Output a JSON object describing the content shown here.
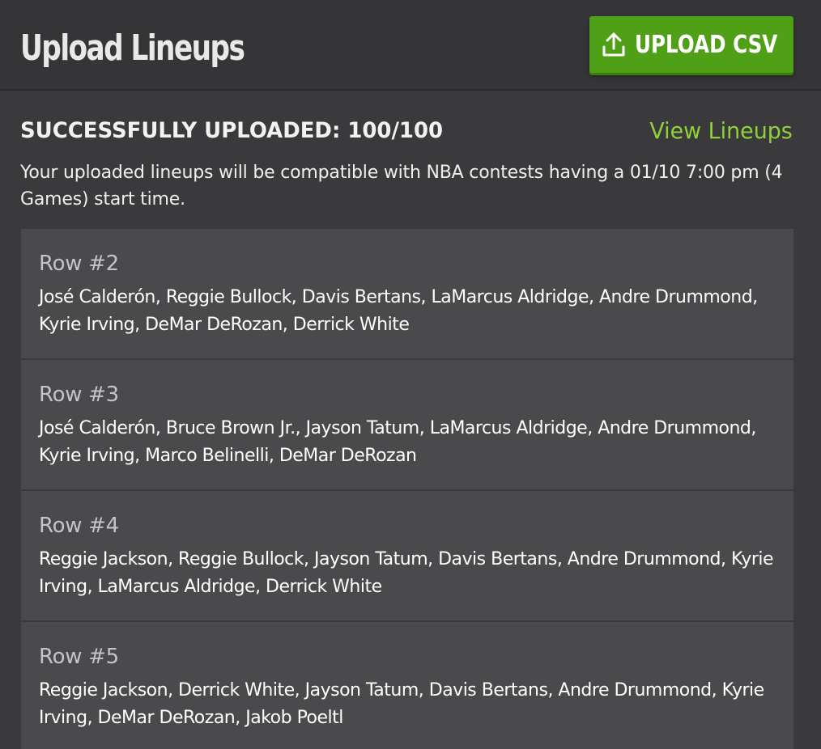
{
  "header": {
    "title": "Upload Lineups",
    "upload_button_label": "UPLOAD CSV",
    "upload_icon": "upload-icon"
  },
  "status": {
    "heading": "SUCCESSFULLY UPLOADED: 100/100",
    "view_link": "View Lineups",
    "description": "Your uploaded lineups will be compatible with NBA contests having a 01/10 7:00 pm (4 Games) start time."
  },
  "rows": [
    {
      "title": "Row #2",
      "players": "José Calderón, Reggie Bullock, Davis Bertans, LaMarcus Aldridge, Andre Drummond, Kyrie Irving, DeMar DeRozan, Derrick White"
    },
    {
      "title": "Row #3",
      "players": "José Calderón, Bruce Brown Jr., Jayson Tatum, LaMarcus Aldridge, Andre Drummond, Kyrie Irving, Marco Belinelli, DeMar DeRozan"
    },
    {
      "title": "Row #4",
      "players": "Reggie Jackson, Reggie Bullock, Jayson Tatum, Davis Bertans, Andre Drummond, Kyrie Irving, LaMarcus Aldridge, Derrick White"
    },
    {
      "title": "Row #5",
      "players": "Reggie Jackson, Derrick White, Jayson Tatum, Davis Bertans, Andre Drummond, Kyrie Irving, DeMar DeRozan, Jakob Poeltl"
    }
  ],
  "colors": {
    "background": "#3a3a3c",
    "header_background": "#353537",
    "card_background": "#4a4a4c",
    "button_green": "#4fa016",
    "link_green": "#8fd13b"
  }
}
